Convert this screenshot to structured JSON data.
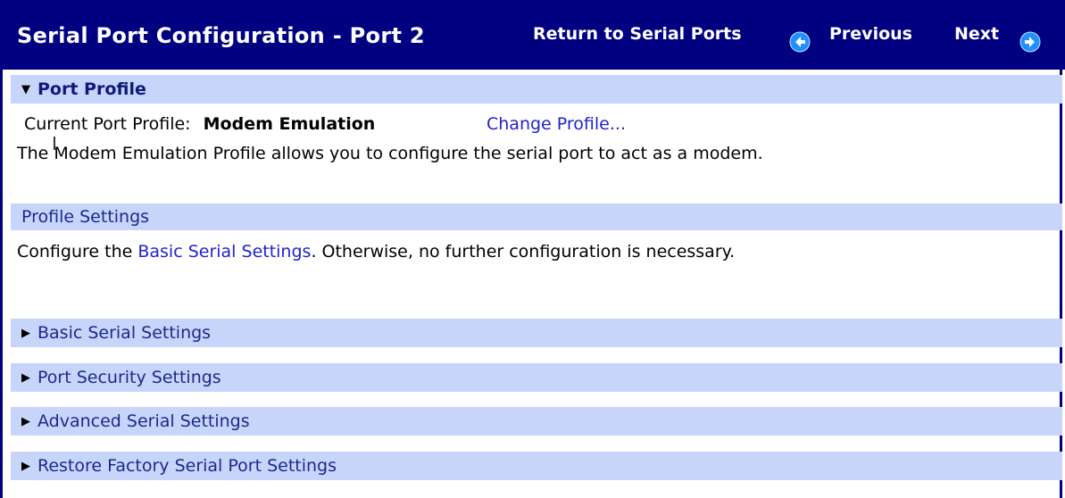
{
  "header": {
    "title": "Serial Port Configuration - Port 2",
    "return_link": "Return to Serial Ports",
    "previous_link": "Previous",
    "next_link": "Next"
  },
  "port_profile": {
    "section_title": "Port Profile",
    "current_label": "Current Port Profile:",
    "current_value": "Modem Emulation",
    "change_link": "Change Profile...",
    "description": "The Modem Emulation Profile allows you to configure the serial port to act as a modem."
  },
  "profile_settings": {
    "section_title": "Profile Settings",
    "text_before": "Configure the ",
    "link": "Basic Serial Settings",
    "text_after": ". Otherwise, no further configuration is necessary."
  },
  "collapsed_sections": [
    "Basic Serial Settings",
    "Port Security Settings",
    "Advanced Serial Settings",
    "Restore Factory Serial Port Settings"
  ],
  "colors": {
    "header_bg": "#000080",
    "section_bg": "#c7d5fb",
    "link": "#2222cc"
  },
  "icons": [
    "arrow-left-circle-icon",
    "arrow-right-circle-icon",
    "triangle-down-icon",
    "triangle-right-icon"
  ]
}
